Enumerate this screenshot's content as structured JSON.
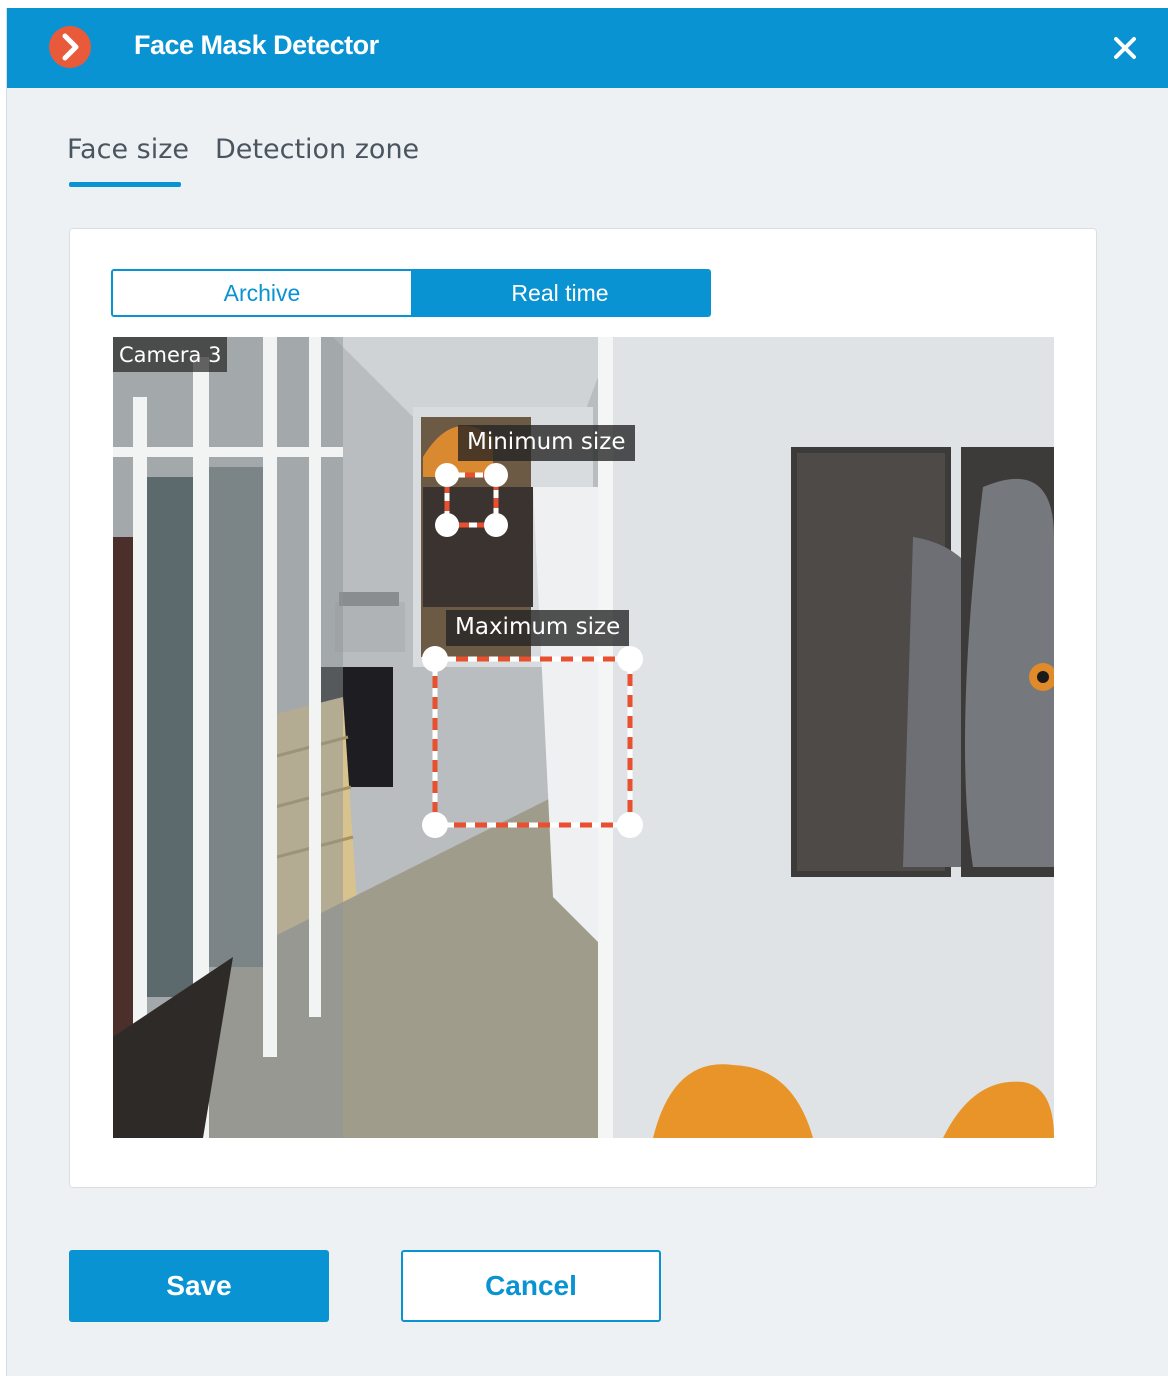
{
  "window": {
    "title": "Face Mask Detector"
  },
  "tabs": [
    {
      "label": "Face size",
      "active": true
    },
    {
      "label": "Detection zone",
      "active": false
    }
  ],
  "mode_switch": {
    "options": [
      "Archive",
      "Real time"
    ],
    "selected": "Real time"
  },
  "video": {
    "camera_label": "Camera 3",
    "min_label": "Minimum size",
    "max_label": "Maximum size"
  },
  "footer": {
    "save_label": "Save",
    "cancel_label": "Cancel"
  },
  "icons": {
    "app_logo": "chevron-right-icon",
    "close": "close-icon"
  },
  "colors": {
    "accent": "#0a93d2",
    "logo": "#e95a3a",
    "frame_dash": "#e8502f"
  }
}
